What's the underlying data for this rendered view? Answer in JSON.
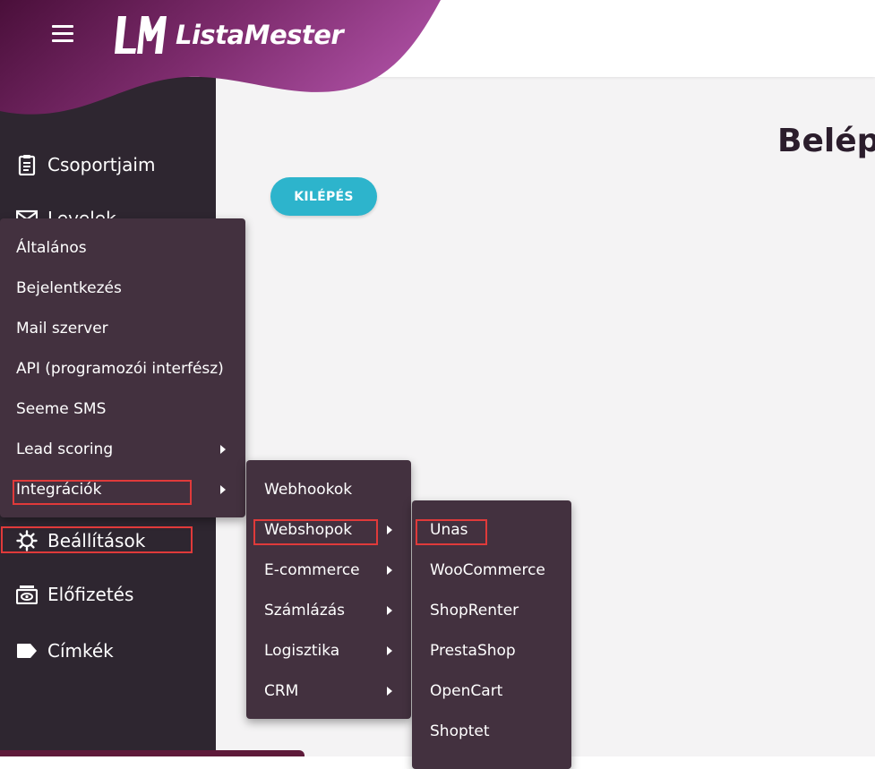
{
  "header": {
    "brand": "ListaMester",
    "colors": {
      "brand_dark": "#4a0f3a",
      "brand_light": "#a84c9e",
      "accent": "#2db4cc"
    }
  },
  "main": {
    "title": "Belépé",
    "logout_button": "KILÉPÉS"
  },
  "sidebar": {
    "items": [
      {
        "label": "Csoportjaim",
        "icon": "clipboard-icon"
      },
      {
        "label": "Levelek",
        "icon": "envelope-icon"
      },
      {
        "label": "Beállítások",
        "icon": "gear-icon"
      },
      {
        "label": "Előfizetés",
        "icon": "subscription-icon"
      },
      {
        "label": "Címkék",
        "icon": "tag-icon"
      }
    ]
  },
  "settings_menu": {
    "items": [
      {
        "label": "Általános"
      },
      {
        "label": "Bejelentkezés"
      },
      {
        "label": "Mail szerver"
      },
      {
        "label": "API (programozói interfész)"
      },
      {
        "label": "Seeme SMS"
      },
      {
        "label": "Lead scoring",
        "has_submenu": true
      },
      {
        "label": "Integrációk",
        "has_submenu": true
      }
    ]
  },
  "integrations_menu": {
    "items": [
      {
        "label": "Webhookok"
      },
      {
        "label": "Webshopok",
        "has_submenu": true
      },
      {
        "label": "E-commerce",
        "has_submenu": true
      },
      {
        "label": "Számlázás",
        "has_submenu": true
      },
      {
        "label": "Logisztika",
        "has_submenu": true
      },
      {
        "label": "CRM",
        "has_submenu": true
      }
    ]
  },
  "webshops_menu": {
    "items": [
      {
        "label": "Unas"
      },
      {
        "label": "WooCommerce"
      },
      {
        "label": "ShopRenter"
      },
      {
        "label": "PrestaShop"
      },
      {
        "label": "OpenCart"
      },
      {
        "label": "Shoptet"
      }
    ]
  }
}
